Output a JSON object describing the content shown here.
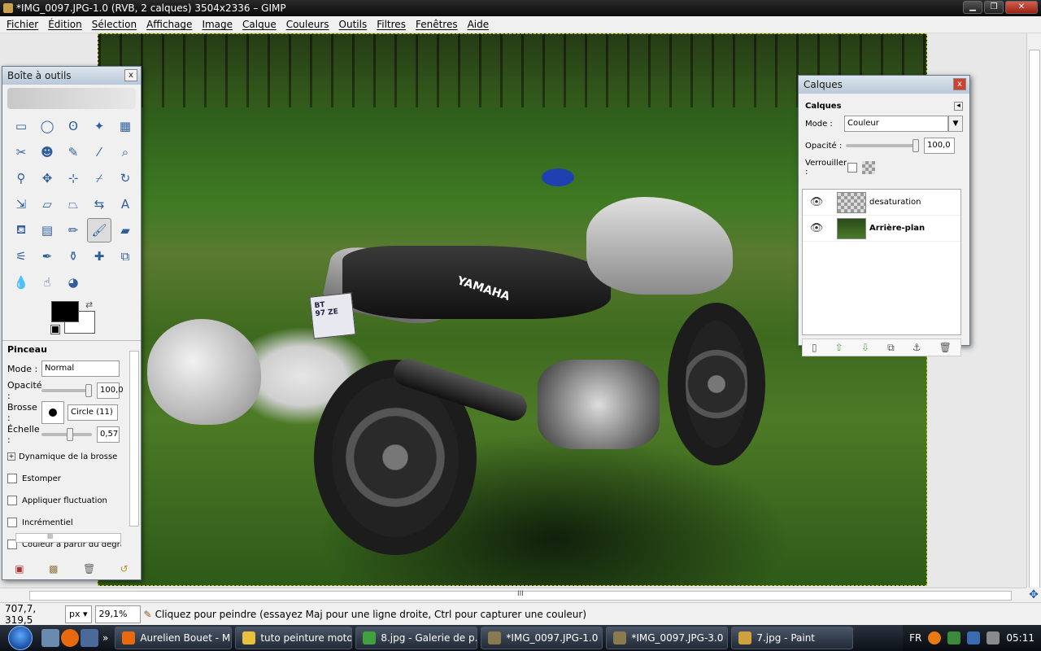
{
  "window": {
    "title": "*IMG_0097.JPG-1.0 (RVB, 2 calques) 3504x2336 – GIMP",
    "buttons": {
      "minimize": "▁",
      "maximize": "❐",
      "close": "✕"
    }
  },
  "menu": [
    "Fichier",
    "Édition",
    "Sélection",
    "Affichage",
    "Image",
    "Calque",
    "Couleurs",
    "Outils",
    "Filtres",
    "Fenêtres",
    "Aide"
  ],
  "toolbox": {
    "title": "Boîte à outils",
    "tools": [
      {
        "name": "rect-select",
        "glyph": "▭"
      },
      {
        "name": "ellipse-select",
        "glyph": "◯"
      },
      {
        "name": "lasso",
        "glyph": "ʘ"
      },
      {
        "name": "fuzzy-select",
        "glyph": "✦"
      },
      {
        "name": "select-by-color",
        "glyph": "▦"
      },
      {
        "name": "scissors",
        "glyph": "✂"
      },
      {
        "name": "foreground-select",
        "glyph": "☻"
      },
      {
        "name": "paths",
        "glyph": "✎"
      },
      {
        "name": "color-picker",
        "glyph": "⁄"
      },
      {
        "name": "zoom",
        "glyph": "⌕"
      },
      {
        "name": "measure",
        "glyph": "⚲"
      },
      {
        "name": "move",
        "glyph": "✥"
      },
      {
        "name": "align",
        "glyph": "⊹"
      },
      {
        "name": "crop",
        "glyph": "⌿"
      },
      {
        "name": "rotate",
        "glyph": "↻"
      },
      {
        "name": "scale",
        "glyph": "⇲"
      },
      {
        "name": "shear",
        "glyph": "▱"
      },
      {
        "name": "perspective",
        "glyph": "⏢"
      },
      {
        "name": "flip",
        "glyph": "⇆"
      },
      {
        "name": "text",
        "glyph": "A"
      },
      {
        "name": "bucket-fill",
        "glyph": "⛾"
      },
      {
        "name": "blend",
        "glyph": "▤"
      },
      {
        "name": "pencil",
        "glyph": "✏"
      },
      {
        "name": "paintbrush",
        "glyph": "🖌"
      },
      {
        "name": "eraser",
        "glyph": "▰"
      },
      {
        "name": "airbrush",
        "glyph": "⚟"
      },
      {
        "name": "ink",
        "glyph": "✒"
      },
      {
        "name": "clone",
        "glyph": "⚱"
      },
      {
        "name": "heal",
        "glyph": "✚"
      },
      {
        "name": "perspective-clone",
        "glyph": "⧉"
      },
      {
        "name": "blur",
        "glyph": "💧"
      },
      {
        "name": "smudge",
        "glyph": "☝"
      },
      {
        "name": "dodge-burn",
        "glyph": "◕"
      }
    ],
    "active_tool": "paintbrush",
    "fg_color": "#000000",
    "bg_color": "#ffffff"
  },
  "tool_options": {
    "title": "Pinceau",
    "mode_label": "Mode :",
    "mode_value": "Normal",
    "opacity_label": "Opacité :",
    "opacity_value": "100,0",
    "opacity_fraction": 1.0,
    "brush_label": "Brosse :",
    "brush_value": "Circle (11)",
    "scale_label": "Échelle :",
    "scale_value": "0,57",
    "scale_fraction": 0.57,
    "dynamics_label": "Dynamique de la brosse",
    "checkboxes": [
      "Estomper",
      "Appliquer fluctuation",
      "Incrémentiel",
      "Couleur à partir du dégradé"
    ],
    "hscroll_grip": "III"
  },
  "layers": {
    "title": "Calques",
    "subtitle": "Calques",
    "mode_label": "Mode :",
    "mode_value": "Couleur",
    "opacity_label": "Opacité :",
    "opacity_value": "100,0",
    "opacity_fraction": 1.0,
    "lock_label": "Verrouiller :",
    "items": [
      {
        "name": "desaturation",
        "visible": true,
        "bold": false
      },
      {
        "name": "Arrière-plan",
        "visible": true,
        "bold": true
      }
    ]
  },
  "statusbar": {
    "coords": "707,7, 319,5",
    "unit": "px",
    "zoom": "29,1%",
    "message": "Cliquez pour peindre (essayez Maj pour une ligne droite, Ctrl pour capturer une couleur)"
  },
  "canvas": {
    "hscroll_grip": "III",
    "plate_text": "BT\n97 ZE",
    "brand_text": "YAMAHA"
  },
  "taskbar": {
    "tasks": [
      {
        "label": "Aurelien Bouet - M...",
        "color": "#e86a10"
      },
      {
        "label": "tuto peinture moto",
        "color": "#e8c040"
      },
      {
        "label": "8.jpg - Galerie de p...",
        "color": "#40a040"
      },
      {
        "label": "*IMG_0097.JPG-1.0 ...",
        "color": "#8a7a50"
      },
      {
        "label": "*IMG_0097.JPG-3.0 ...",
        "color": "#8a7a50"
      },
      {
        "label": "7.jpg - Paint",
        "color": "#d0a040"
      }
    ],
    "language": "FR",
    "time": "05:11"
  }
}
